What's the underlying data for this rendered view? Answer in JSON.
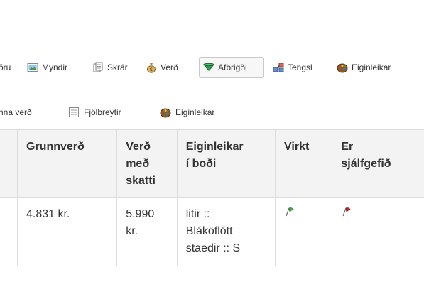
{
  "tabs": [
    {
      "label": "öru"
    },
    {
      "label": "Myndir",
      "icon": "image-icon"
    },
    {
      "label": "Skrár",
      "icon": "files-icon"
    },
    {
      "label": "Verð",
      "icon": "money-bag-icon"
    },
    {
      "label": "Afbrigði",
      "icon": "funnel-icon",
      "active": true
    },
    {
      "label": "Tengsl",
      "icon": "links-icon"
    },
    {
      "label": "Eiginleikar",
      "icon": "palette-icon"
    }
  ],
  "subtabs": [
    {
      "label": "nna verð"
    },
    {
      "label": "Fjölbreytir",
      "icon": "list-icon"
    },
    {
      "label": "Eiginleikar",
      "icon": "palette-icon"
    }
  ],
  "table": {
    "headers": {
      "base_price": [
        "Grunnverð"
      ],
      "price_tax": [
        "Verð",
        "með",
        "skatti"
      ],
      "attributes": [
        "Eiginleikar",
        "í boði"
      ],
      "active": [
        "Virkt"
      ],
      "default": [
        "Er",
        "sjálfgefið"
      ]
    },
    "row": {
      "base_price": "4.831 kr.",
      "price_tax": [
        "5.990",
        "kr."
      ],
      "attributes": [
        "litir ::",
        "Bláköflótt",
        "staedir :: S"
      ],
      "active_icon": "green-flag-icon",
      "default_icon": "red-flag-icon"
    }
  },
  "colors": {
    "green_flag": "#4caf50",
    "red_flag": "#c62828",
    "header_bg": "#f3f3f3",
    "border": "#dddddd"
  }
}
